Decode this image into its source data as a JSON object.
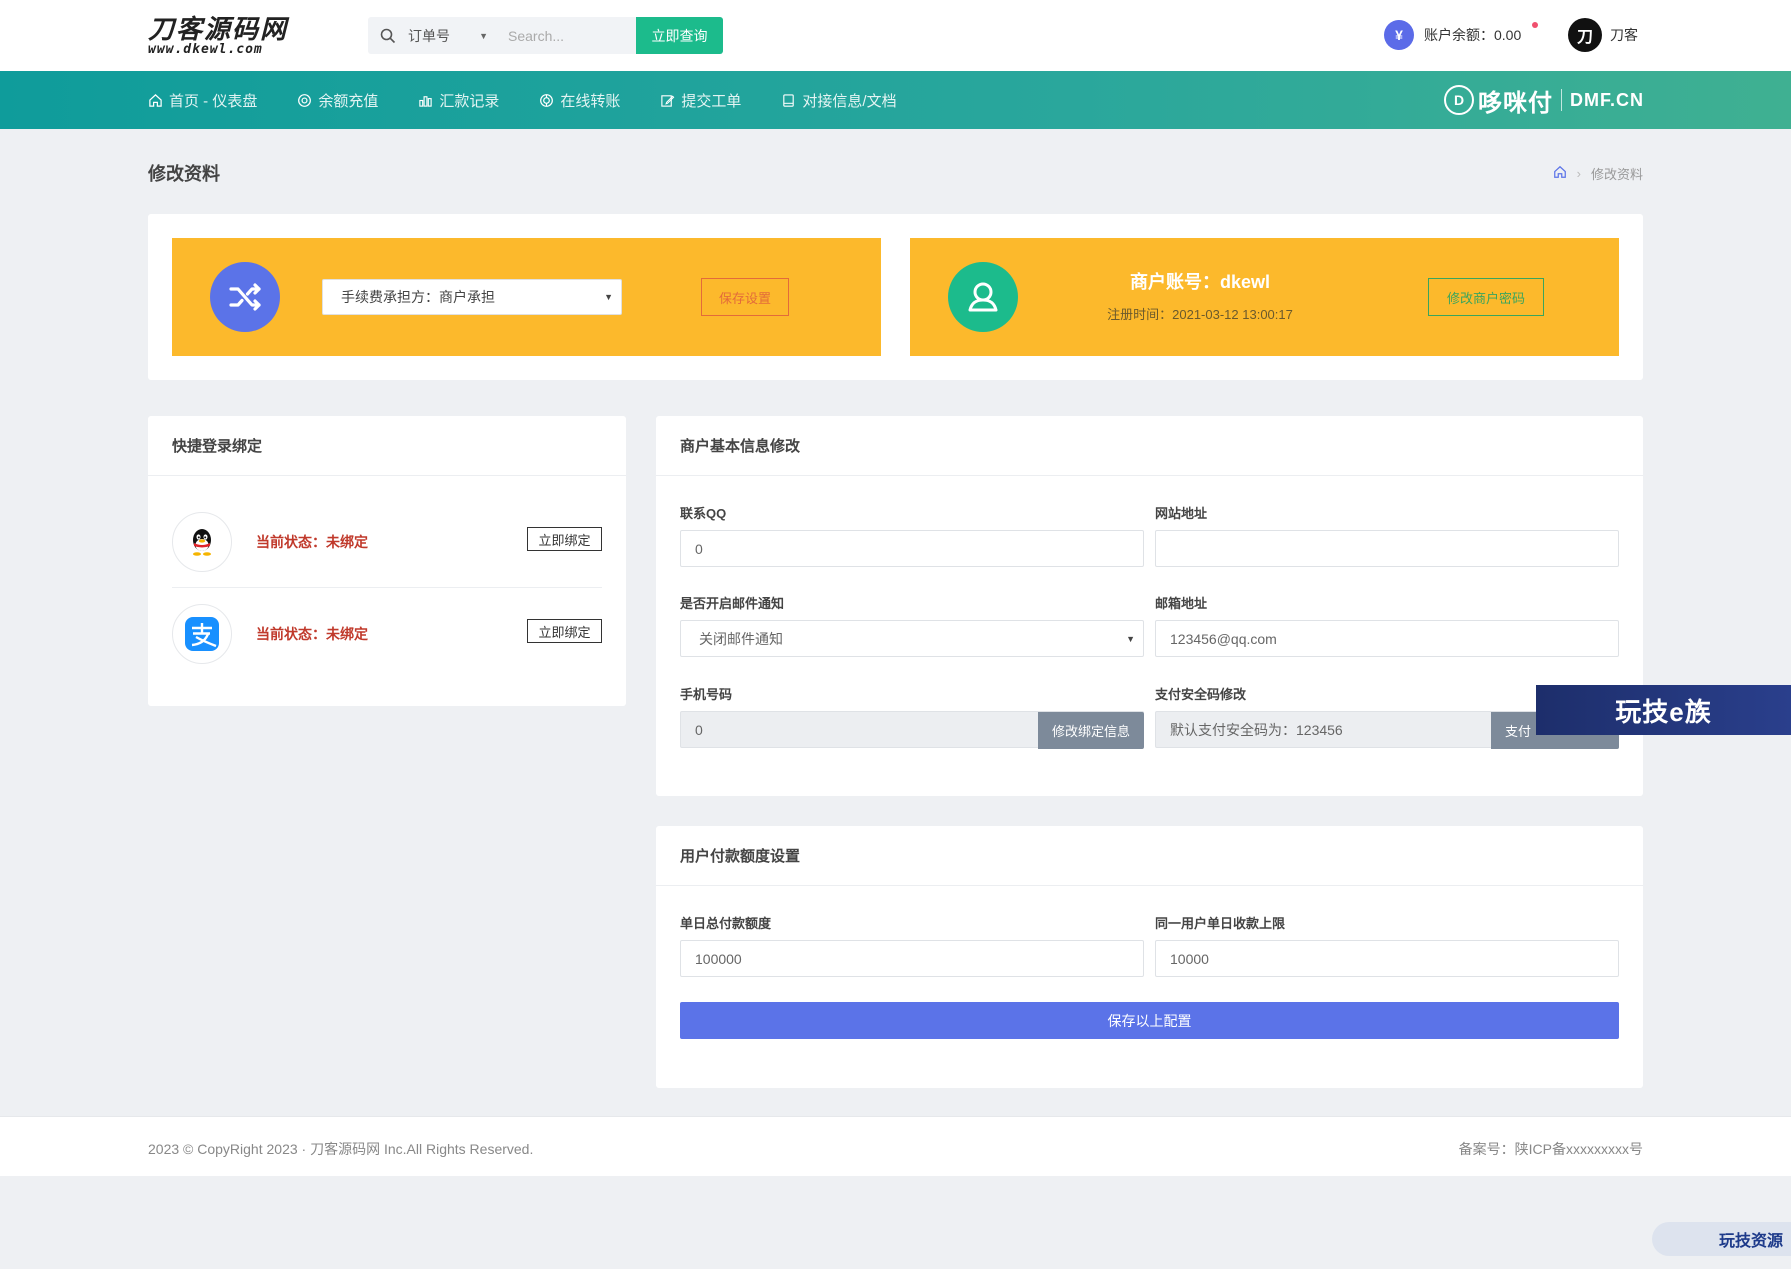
{
  "header": {
    "logo_main": "刀客源码网",
    "logo_sub": "www.dkewl.com",
    "search_type": "订单号",
    "search_placeholder": "Search...",
    "search_button": "立即查询",
    "balance_label": "账户余额：0.00",
    "balance_icon_glyph": "¥",
    "user_logo_glyph": "刀",
    "user_name": "刀客"
  },
  "nav": {
    "items": [
      {
        "label": "首页 - 仪表盘",
        "icon": "home-icon"
      },
      {
        "label": "余额充值",
        "icon": "recharge-icon"
      },
      {
        "label": "汇款记录",
        "icon": "chart-icon"
      },
      {
        "label": "在线转账",
        "icon": "transfer-icon"
      },
      {
        "label": "提交工单",
        "icon": "edit-icon"
      },
      {
        "label": "对接信息/文档",
        "icon": "document-icon"
      }
    ],
    "brand_glyph": "D",
    "brand_name": "哆咪付",
    "brand_domain": "DMF.CN"
  },
  "page": {
    "title": "修改资料",
    "breadcrumb_current": "修改资料"
  },
  "fee_panel": {
    "select_value": "手续费承担方：商户承担",
    "save_button": "保存设置"
  },
  "merchant_panel": {
    "account": "商户账号：dkewl",
    "reg_time": "注册时间：2021-03-12 13:00:17",
    "change_pwd_button": "修改商户密码"
  },
  "bind_card": {
    "title": "快捷登录绑定",
    "rows": [
      {
        "status": "当前状态：未绑定",
        "button": "立即绑定",
        "icon": "qq-icon"
      },
      {
        "status": "当前状态：未绑定",
        "button": "立即绑定",
        "icon": "alipay-icon"
      }
    ]
  },
  "info_card": {
    "title": "商户基本信息修改",
    "qq_label": "联系QQ",
    "qq_value": "0",
    "website_label": "网站地址",
    "website_value": "",
    "email_notify_label": "是否开启邮件通知",
    "email_notify_value": "关闭邮件通知",
    "email_label": "邮箱地址",
    "email_value": "123456@qq.com",
    "phone_label": "手机号码",
    "phone_value": "0",
    "phone_button": "修改绑定信息",
    "paycode_label": "支付安全码修改",
    "paycode_value": "默认支付安全码为：123456",
    "paycode_button": "支付"
  },
  "limit_card": {
    "title": "用户付款额度设置",
    "daily_total_label": "单日总付款额度",
    "daily_total_value": "100000",
    "per_user_label": "同一用户单日收款上限",
    "per_user_value": "10000",
    "save_button": "保存以上配置"
  },
  "footer": {
    "copyright": "2023 © CopyRight 2023 · 刀客源码网 Inc.All Rights Reserved.",
    "icp": "备案号：陕ICP备xxxxxxxxx号"
  },
  "watermarks": {
    "banner": "玩技e族",
    "bottom": "玩技资源"
  },
  "colors": {
    "accent_green": "#1cbb8c",
    "nav_teal": "#0f9c9b",
    "panel_yellow": "#fcb92c",
    "primary_blue": "#5b73e8",
    "status_red": "#c0392b"
  }
}
